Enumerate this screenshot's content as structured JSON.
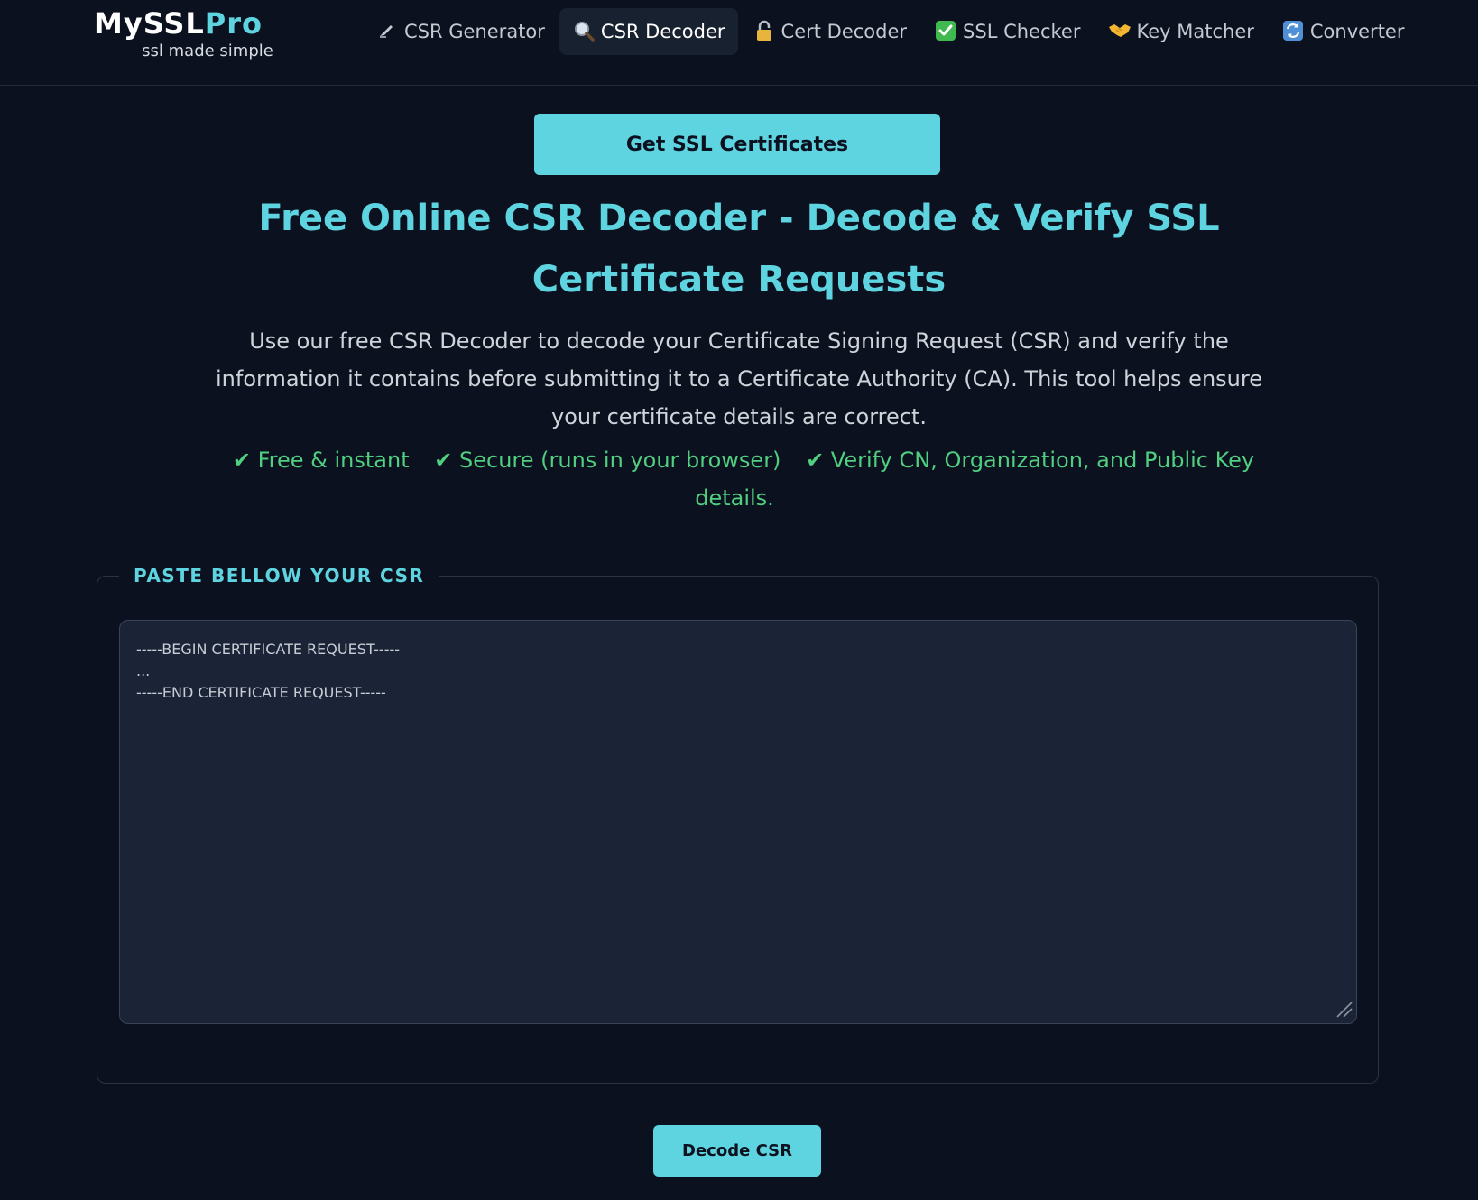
{
  "brand": {
    "name_part1": "MySSL",
    "name_part2": "Pro",
    "tagline": "ssl made simple"
  },
  "nav": {
    "items": [
      {
        "label": "CSR Generator",
        "icon": "pen-icon"
      },
      {
        "label": "CSR Decoder",
        "icon": "magnifier-icon",
        "active": true
      },
      {
        "label": "Cert Decoder",
        "icon": "padlock-icon"
      },
      {
        "label": "SSL Checker",
        "icon": "checkmark-box-icon"
      },
      {
        "label": "Key Matcher",
        "icon": "handshake-icon"
      },
      {
        "label": "Converter",
        "icon": "refresh-icon"
      }
    ]
  },
  "cta": {
    "label": "Get SSL Certificates"
  },
  "hero": {
    "title": "Free Online CSR Decoder - Decode & Verify SSL Certificate Requests",
    "description": "Use our free CSR Decoder to decode your Certificate Signing Request (CSR) and verify the information it contains before submitting it to a Certificate Authority (CA). This tool helps ensure your certificate details are correct.",
    "features": [
      "✔ Free & instant",
      "✔ Secure (runs in your browser)",
      "✔ Verify CN, Organization, and Public Key details."
    ]
  },
  "form": {
    "legend": "PASTE BELLOW YOUR CSR",
    "placeholder": "-----BEGIN CERTIFICATE REQUEST-----\n...\n-----END CERTIFICATE REQUEST-----",
    "submit_label": "Decode CSR"
  },
  "colors": {
    "background": "#0b111e",
    "accent": "#5fd4e1",
    "success": "#4fcf7f",
    "nav_active_bg": "#18212f",
    "textarea_bg": "#1b2437"
  }
}
